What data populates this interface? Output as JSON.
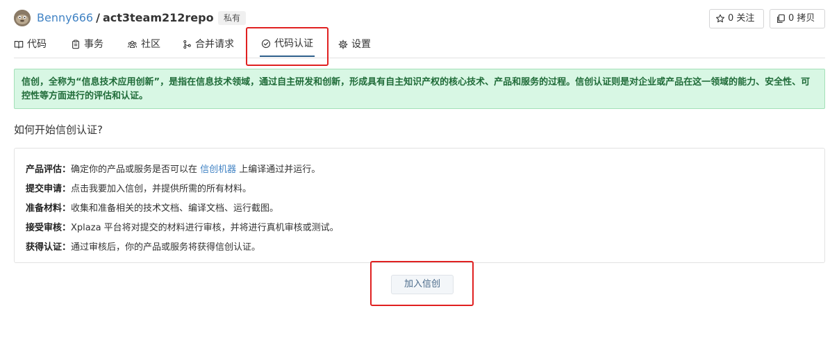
{
  "header": {
    "owner": "Benny666",
    "separator": "/",
    "repo_name": "act3team212repo",
    "badge": "私有",
    "watch_label": "0 关注",
    "fork_label": "0 拷贝"
  },
  "tabs": [
    {
      "label": "代码",
      "icon": "book-icon"
    },
    {
      "label": "事务",
      "icon": "clipboard-icon"
    },
    {
      "label": "社区",
      "icon": "people-icon"
    },
    {
      "label": "合并请求",
      "icon": "git-merge-icon"
    },
    {
      "label": "代码认证",
      "icon": "check-circle-icon",
      "active": true
    },
    {
      "label": "设置",
      "icon": "gear-icon"
    }
  ],
  "banner": {
    "text": "信创，全称为“信息技术应用创新”，是指在信息技术领域，通过自主研发和创新，形成具有自主知识产权的核心技术、产品和服务的过程。信创认证则是对企业或产品在这一领域的能力、安全性、可控性等方面进行的评估和认证。"
  },
  "section_title": "如何开始信创认证?",
  "steps": [
    {
      "label": "产品评估：",
      "text_before": "确定你的产品或服务是否可以在 ",
      "link": "信创机器",
      "text_after": " 上编译通过并运行。"
    },
    {
      "label": "提交申请：",
      "text_before": "点击我要加入信创，并提供所需的所有材料。"
    },
    {
      "label": "准备材料：",
      "text_before": "收集和准备相关的技术文档、编译文档、运行截图。"
    },
    {
      "label": "接受审核：",
      "text_before": "Xplaza 平台将对提交的材料进行审核，并将进行真机审核或测试。"
    },
    {
      "label": "获得认证：",
      "text_before": "通过审核后，你的产品或服务将获得信创认证。"
    }
  ],
  "join_button": "加入信创",
  "colors": {
    "link": "#4183c4",
    "banner_bg": "#d8f7e4",
    "banner_text": "#1f6b38",
    "highlight": "#e02020",
    "active_tab_underline": "#2c5e8a"
  }
}
